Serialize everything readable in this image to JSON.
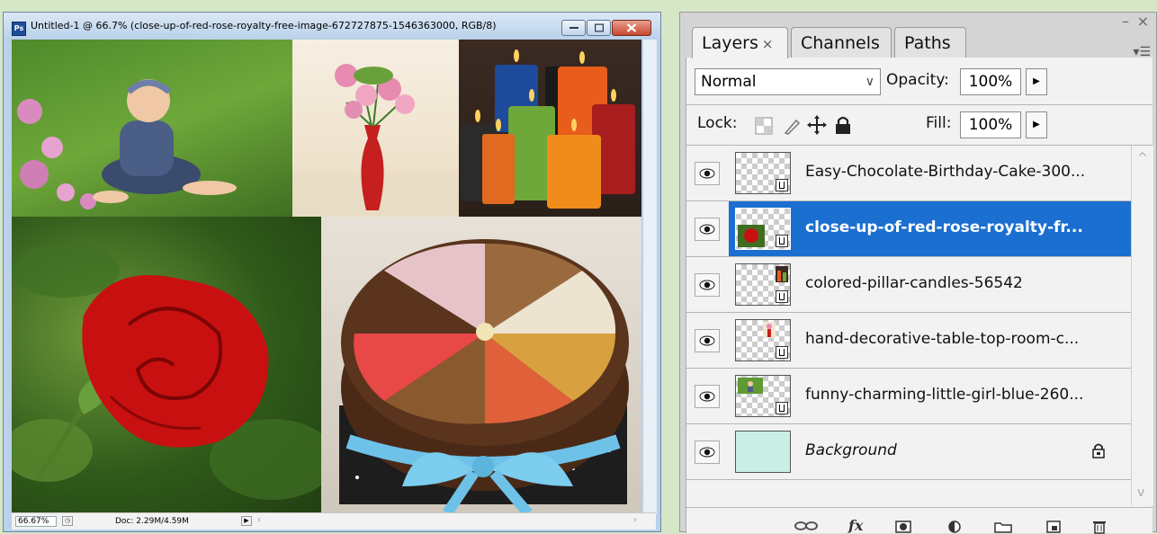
{
  "document": {
    "title": "Untitled-1 @ 66.7% (close-up-of-red-rose-royalty-free-image-672727875-1546363000, RGB/8)",
    "app_icon": "Ps",
    "zoom": "66.67%",
    "doc_info": "Doc: 2.29M/4.59M"
  },
  "panel": {
    "tabs": [
      {
        "label": "Layers",
        "close": "×"
      },
      {
        "label": "Channels"
      },
      {
        "label": "Paths"
      }
    ],
    "blend_mode": "Normal",
    "opacity_label": "Opacity:",
    "opacity_value": "100%",
    "lock_label": "Lock:",
    "fill_label": "Fill:",
    "fill_value": "100%",
    "layers": [
      {
        "name": "Easy-Chocolate-Birthday-Cake-300...",
        "selected": false
      },
      {
        "name": "close-up-of-red-rose-royalty-fr...",
        "selected": true
      },
      {
        "name": "colored-pillar-candles-56542",
        "selected": false
      },
      {
        "name": "hand-decorative-table-top-room-c...",
        "selected": false
      },
      {
        "name": "funny-charming-little-girl-blue-260...",
        "selected": false
      },
      {
        "name": "Background",
        "selected": false
      }
    ],
    "footer_fx": "fx"
  },
  "colors": {
    "selection": "#1a6fd0",
    "background_layer": "#c8eee6",
    "desktop": "#d6e7c8"
  }
}
